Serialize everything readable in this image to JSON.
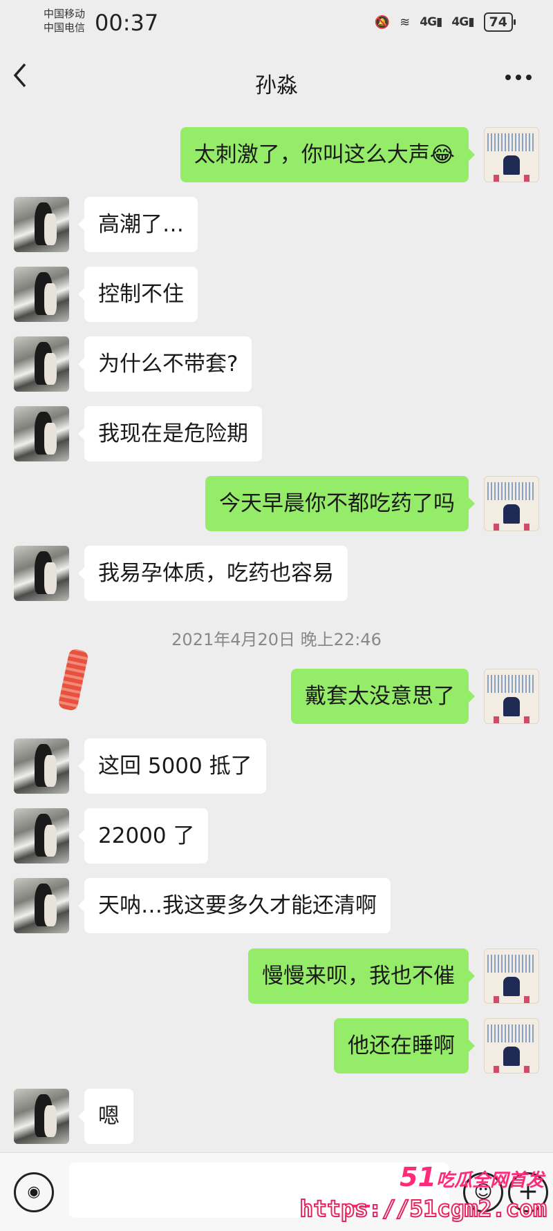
{
  "status_bar": {
    "carrier1": "中国移动",
    "carrier2": "中国电信",
    "time": "00:37",
    "network1": "4G",
    "network2": "4G",
    "battery": "74"
  },
  "header": {
    "back_icon": "chevron-left-icon",
    "title": "孙淼",
    "more_icon": "ellipsis-icon"
  },
  "messages": [
    {
      "from": "me",
      "text": "太刺激了，你叫这么大声😂"
    },
    {
      "from": "other",
      "text": "高潮了…"
    },
    {
      "from": "other",
      "text": "控制不住"
    },
    {
      "from": "other",
      "text": "为什么不带套?"
    },
    {
      "from": "other",
      "text": "我现在是危险期"
    },
    {
      "from": "me",
      "text": "今天早晨你不都吃药了吗"
    },
    {
      "from": "other",
      "text": "我易孕体质，吃药也容易"
    },
    {
      "from": "me",
      "text": "戴套太没意思了"
    },
    {
      "from": "other",
      "text": "这回 5000 抵了"
    },
    {
      "from": "other",
      "text": "22000 了"
    },
    {
      "from": "other",
      "text": "天呐…我这要多久才能还清啊"
    },
    {
      "from": "me",
      "text": "慢慢来呗，我也不催"
    },
    {
      "from": "me",
      "text": "他还在睡啊"
    },
    {
      "from": "other",
      "text": "嗯"
    }
  ],
  "timestamp": "2021年4月20日 晚上22:46",
  "watermark": {
    "line1_num": "51",
    "line1_text": "吃瓜全网首发",
    "line2": "https://51cgm2.com"
  },
  "colors": {
    "background": "#ededed",
    "my_bubble": "#95ec69",
    "other_bubble": "#ffffff",
    "watermark": "#ff2a78"
  }
}
